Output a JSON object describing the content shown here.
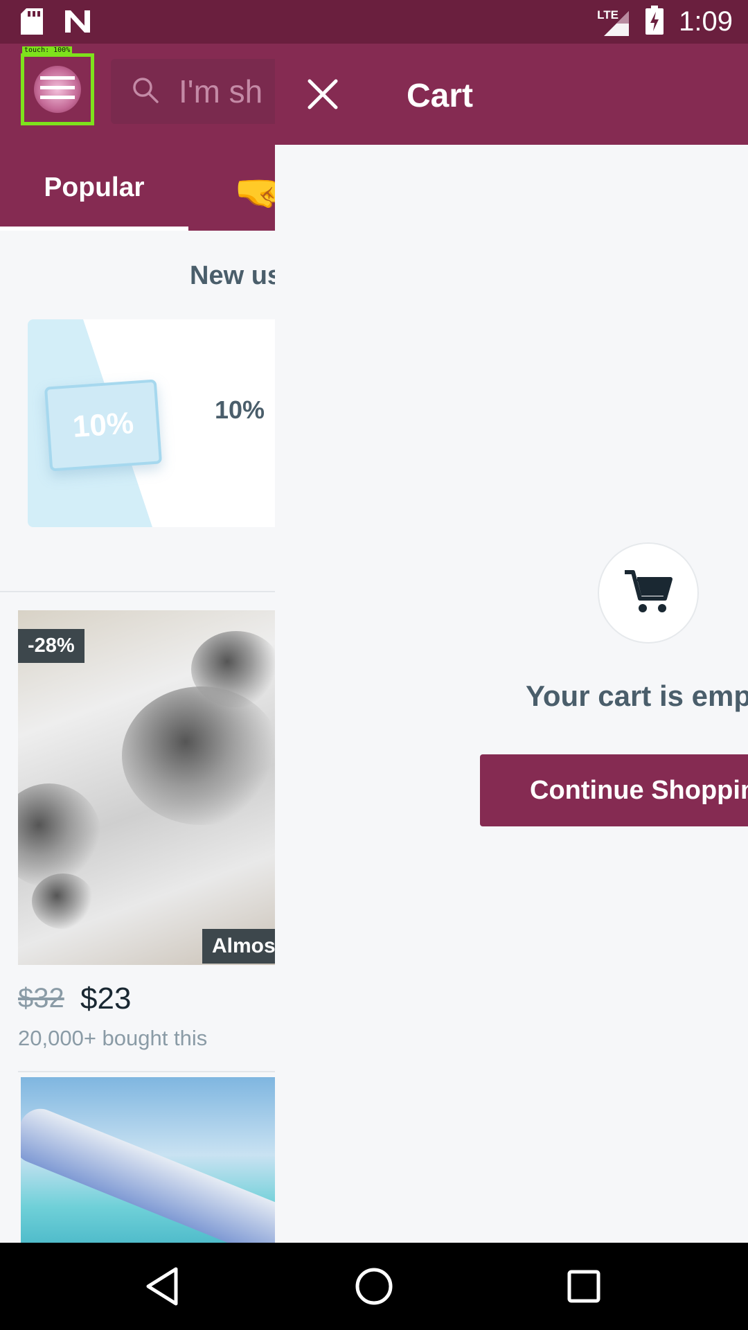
{
  "status_bar": {
    "network_label": "LTE",
    "time": "1:09"
  },
  "header": {
    "search_placeholder": "I'm sh",
    "debug_touch_label": "touch: 100%"
  },
  "tabs": {
    "popular": "Popular",
    "next_emoji": "🤜"
  },
  "promo": {
    "title": "New us",
    "coupon_ticket": "10%",
    "coupon_text": "10%"
  },
  "product": {
    "discount": "-28%",
    "badge": "Almos",
    "old_price": "$32",
    "new_price": "$23",
    "bought": "20,000+ bought this"
  },
  "cart": {
    "title": "Cart",
    "empty_message": "Your cart is empt",
    "continue_button": "Continue Shoppin"
  },
  "colors": {
    "brand": "#852b52",
    "status_bar": "#6a1f3e",
    "touch_highlight": "#7ee21c"
  }
}
